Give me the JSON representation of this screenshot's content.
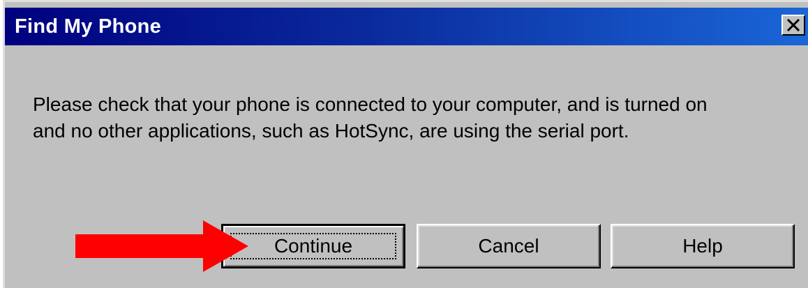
{
  "window": {
    "title": "Find My Phone",
    "close_icon": "close-x-icon"
  },
  "message": {
    "line1": "Please check that your phone is connected to your computer, and is turned on",
    "line2": "and no other applications, such as HotSync, are using the serial port."
  },
  "buttons": {
    "continue": "Continue",
    "cancel": "Cancel",
    "help": "Help"
  },
  "annotation": {
    "icon": "red-arrow-icon",
    "color": "#ff0000"
  },
  "colors": {
    "titlebar_start": "#00007f",
    "titlebar_end": "#1a66d8",
    "dialog_bg": "#c0c0c0"
  }
}
